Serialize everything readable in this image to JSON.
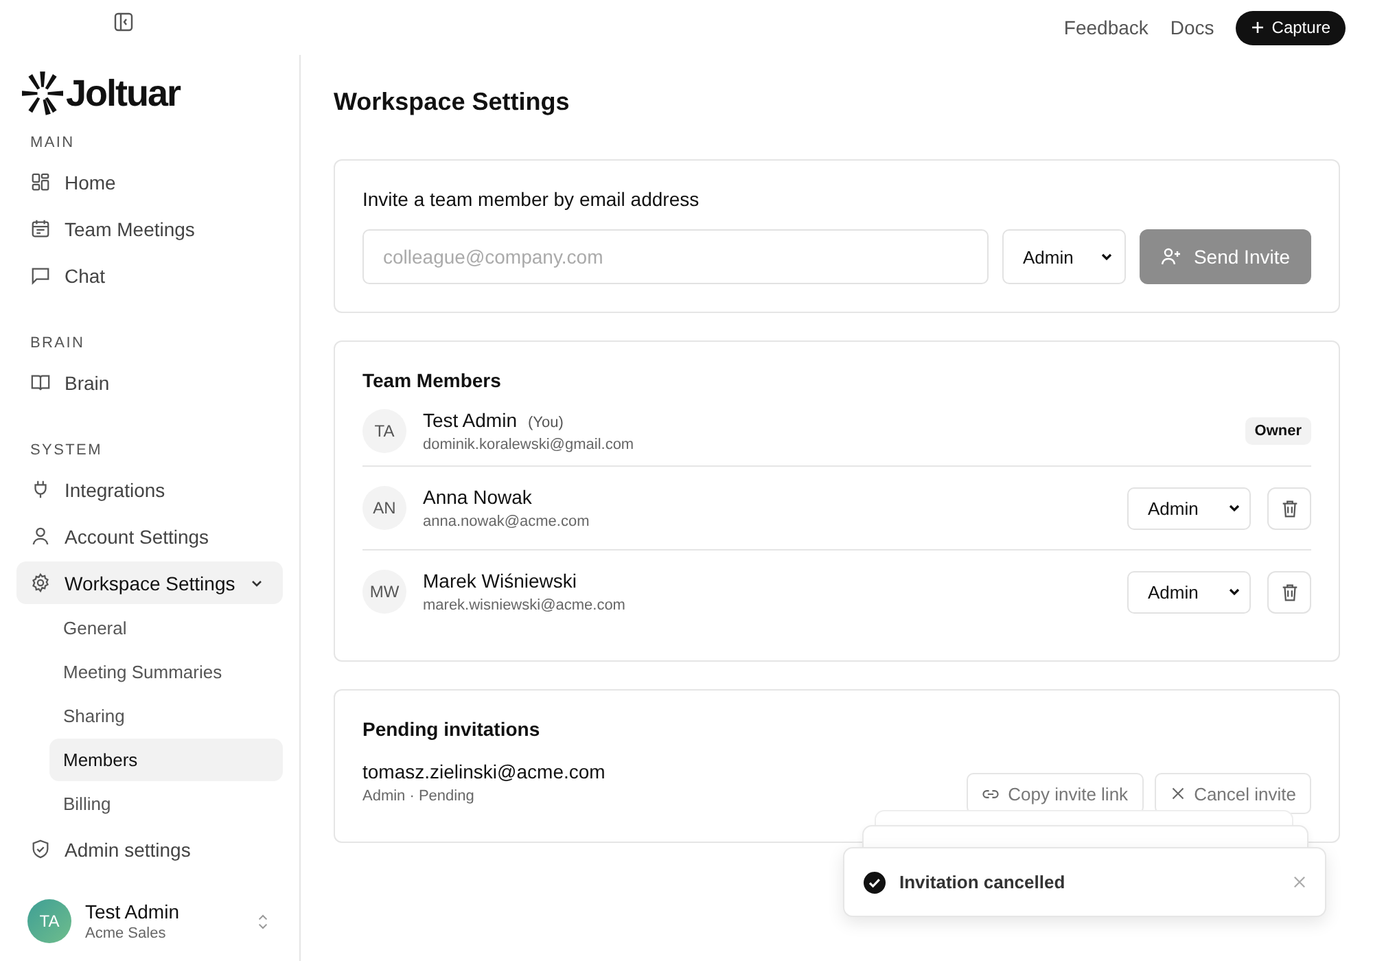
{
  "topbar": {
    "links": [
      "Feedback",
      "Docs"
    ],
    "capture_button": "Capture"
  },
  "sidebar": {
    "brand": "Joltuar",
    "sections": [
      {
        "heading": "MAIN",
        "items": [
          {
            "label": "Home",
            "selected": false
          },
          {
            "label": "Team Meetings",
            "selected": false
          },
          {
            "label": "Chat",
            "selected": false
          }
        ]
      },
      {
        "heading": "BRAIN",
        "items": [
          {
            "label": "Brain",
            "selected": false
          }
        ]
      },
      {
        "heading": "SYSTEM",
        "items": [
          {
            "label": "Integrations",
            "selected": false
          },
          {
            "label": "Account Settings",
            "selected": false
          },
          {
            "label": "Workspace Settings",
            "selected": true,
            "expanded": true,
            "children": [
              {
                "label": "General",
                "selected": false
              },
              {
                "label": "Meeting Summaries",
                "selected": false
              },
              {
                "label": "Sharing",
                "selected": false
              },
              {
                "label": "Members",
                "selected": true
              },
              {
                "label": "Billing",
                "selected": false
              }
            ]
          },
          {
            "label": "Admin settings",
            "selected": false
          }
        ]
      }
    ],
    "user": {
      "initials": "TA",
      "name": "Test Admin",
      "workspace": "Acme Sales"
    }
  },
  "page_title": "Workspace Settings",
  "invite": {
    "label": "Invite a team member by email address",
    "placeholder": "colleague@company.com",
    "role": "Admin",
    "button": "Send Invite",
    "disabled": true
  },
  "team": {
    "title": "Team Members",
    "members": [
      {
        "kind": "owner",
        "initials": "TA",
        "name": "Test Admin",
        "tag": "(You)",
        "email": "dominik.koralewski@gmail.com",
        "badge": "Owner"
      },
      {
        "kind": "member",
        "initials": "AN",
        "name": "Anna Nowak",
        "email": "anna.nowak@acme.com",
        "role": "Admin"
      },
      {
        "kind": "member",
        "initials": "MW",
        "name": "Marek Wiśniewski",
        "email": "marek.wisniewski@acme.com",
        "role": "Admin"
      }
    ]
  },
  "pending": {
    "title": "Pending invitations",
    "invitations": [
      {
        "email": "tomasz.zielinski@acme.com",
        "meta": "Admin · Pending",
        "actions": [
          "Copy invite link",
          "Cancel invite"
        ]
      }
    ]
  },
  "toast": {
    "message": "Invitation cancelled"
  }
}
